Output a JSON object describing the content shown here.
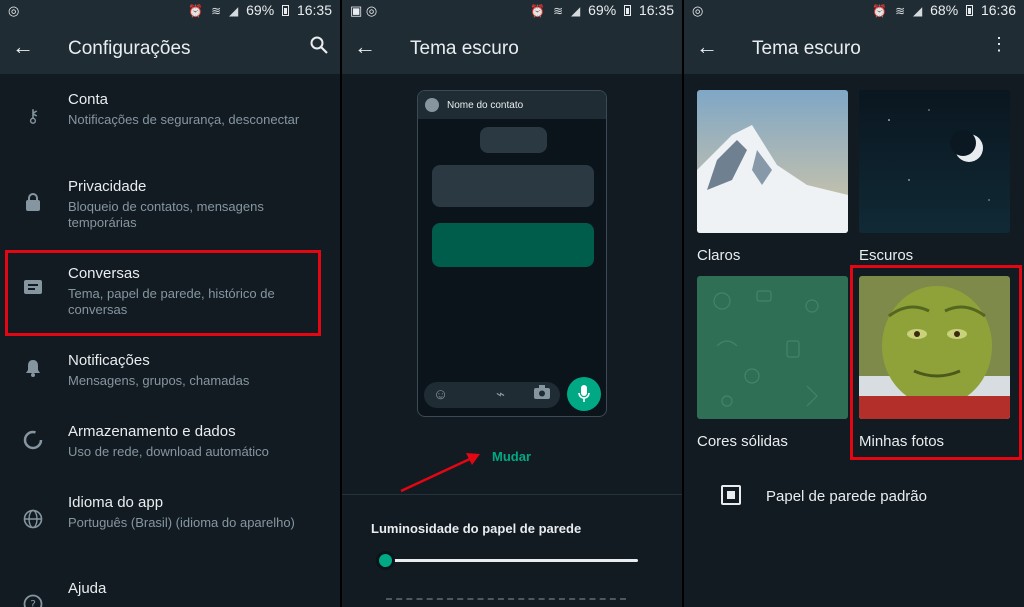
{
  "panel1": {
    "status": {
      "left_icon": "whatsapp-icon",
      "battery": "69%",
      "time": "16:35"
    },
    "title": "Configurações",
    "settings": [
      {
        "icon": "key-icon",
        "title": "Conta",
        "subtitle": "Notificações de segurança, desconectar"
      },
      {
        "icon": "lock-icon",
        "title": "Privacidade",
        "subtitle": "Bloqueio de contatos, mensagens temporárias"
      },
      {
        "icon": "chat-icon",
        "title": "Conversas",
        "subtitle": "Tema, papel de parede, histórico de conversas"
      },
      {
        "icon": "bell-icon",
        "title": "Notificações",
        "subtitle": "Mensagens, grupos, chamadas"
      },
      {
        "icon": "data-usage-icon",
        "title": "Armazenamento e dados",
        "subtitle": "Uso de rede, download automático"
      },
      {
        "icon": "globe-icon",
        "title": "Idioma do app",
        "subtitle": "Português (Brasil) (idioma do aparelho)"
      },
      {
        "icon": "help-icon",
        "title": "Ajuda",
        "subtitle": ""
      }
    ]
  },
  "panel2": {
    "status": {
      "battery": "69%",
      "time": "16:35"
    },
    "title": "Tema escuro",
    "preview_contact": "Nome do contato",
    "change_label": "Mudar",
    "brightness_label": "Luminosidade do papel de parede",
    "brightness_level": 0.0
  },
  "panel3": {
    "status": {
      "battery": "68%",
      "time": "16:36"
    },
    "title": "Tema escuro",
    "categories": [
      {
        "label": "Claros"
      },
      {
        "label": "Escuros"
      },
      {
        "label": "Cores sólidas"
      },
      {
        "label": "Minhas fotos"
      }
    ],
    "default_wallpaper_label": "Papel de parede padrão"
  },
  "colors": {
    "accent": "#00a884",
    "highlight": "#e30613",
    "background": "#121b22",
    "bar": "#1f2c34"
  }
}
